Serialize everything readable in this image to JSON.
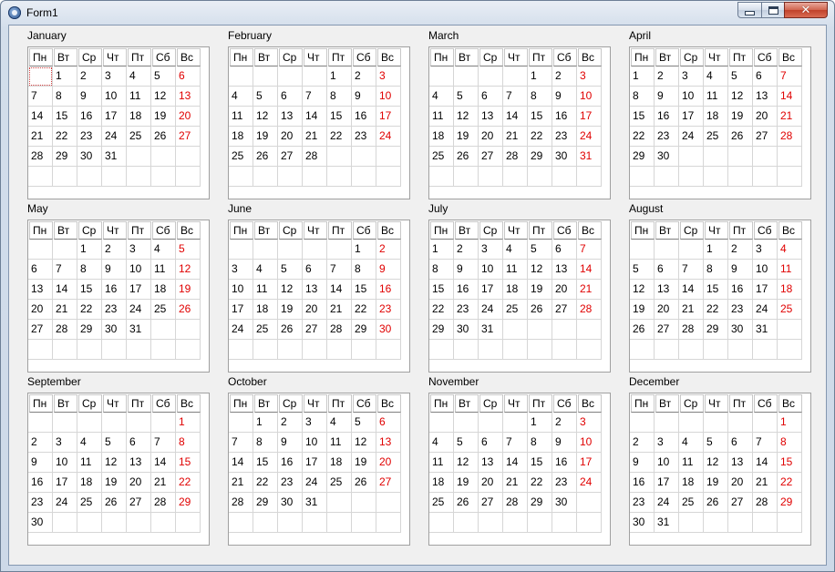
{
  "window": {
    "title": "Form1"
  },
  "colors": {
    "sunday": "#e00000",
    "grid_line": "#d6d6d6"
  },
  "weekdays": [
    "Пн",
    "Вт",
    "Ср",
    "Чт",
    "Пт",
    "Сб",
    "Вс"
  ],
  "months": [
    {
      "name": "January",
      "first_weekday": 1,
      "days": 31
    },
    {
      "name": "February",
      "first_weekday": 4,
      "days": 28
    },
    {
      "name": "March",
      "first_weekday": 4,
      "days": 31
    },
    {
      "name": "April",
      "first_weekday": 0,
      "days": 30
    },
    {
      "name": "May",
      "first_weekday": 2,
      "days": 31
    },
    {
      "name": "June",
      "first_weekday": 5,
      "days": 30
    },
    {
      "name": "July",
      "first_weekday": 0,
      "days": 31
    },
    {
      "name": "August",
      "first_weekday": 3,
      "days": 31
    },
    {
      "name": "September",
      "first_weekday": 6,
      "days": 30
    },
    {
      "name": "October",
      "first_weekday": 1,
      "days": 31
    },
    {
      "name": "November",
      "first_weekday": 4,
      "days": 30
    },
    {
      "name": "December",
      "first_weekday": 6,
      "days": 31
    }
  ],
  "focused": {
    "month_index": 0,
    "row": 0,
    "col": 0
  }
}
